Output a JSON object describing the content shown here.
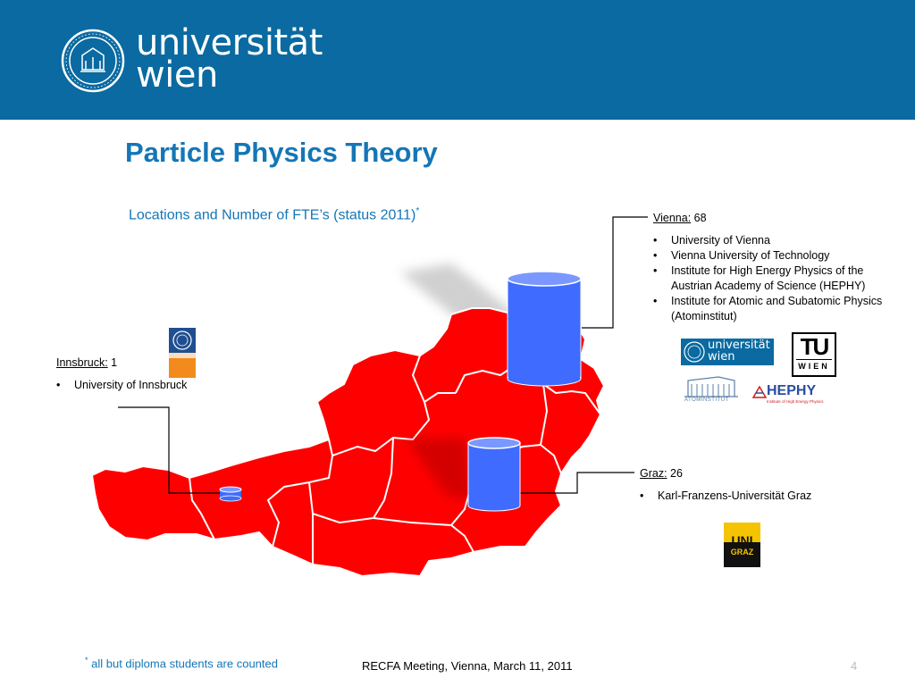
{
  "header": {
    "brand_line1": "universität",
    "brand_line2": "wien",
    "bg_color": "#0a6aa1"
  },
  "slide": {
    "title": "Particle Physics Theory",
    "subtitle": "Locations and Number of FTE’s (status 2011)",
    "subtitle_marker": "*"
  },
  "locations": {
    "innsbruck": {
      "name": "Innsbruck:",
      "fte": "1",
      "institutions": [
        "University of Innsbruck"
      ]
    },
    "vienna": {
      "name": "Vienna:",
      "fte": "68",
      "institutions": [
        "University of Vienna",
        "Vienna University of Technology",
        "Institute for High Energy Physics of the Austrian Academy of Science (HEPHY)",
        "Institute for Atomic and Subatomic Physics (Atominstitut)"
      ]
    },
    "graz": {
      "name": "Graz:",
      "fte": "26",
      "institutions": [
        "Karl-Franzens-Universität Graz"
      ]
    }
  },
  "logos": {
    "uni_wien_line1": "universität",
    "uni_wien_line2": "wien",
    "tu_top": "TU",
    "tu_bottom": "WIEN",
    "atominstitut": "ATOMINSTITUT",
    "hephy": "HEPHY",
    "hephy_sub": "Institute of High Energy Physics",
    "uni_graz_top": "UNI",
    "uni_graz_bottom": "GRAZ"
  },
  "colors": {
    "map_fill": "#ff0000",
    "map_stroke": "#ffffff",
    "cylinder": "#3f6bff",
    "title": "#1476b6"
  },
  "footer": {
    "footnote_marker": "*",
    "footnote": " all but diploma students are counted",
    "meeting": "RECFA Meeting, Vienna, March 11, 2011",
    "page": "4"
  }
}
